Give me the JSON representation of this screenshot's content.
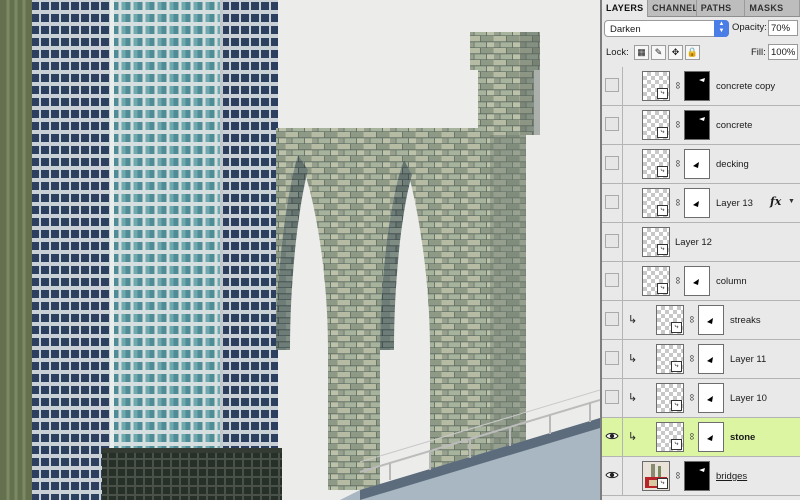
{
  "panel": {
    "tabs": [
      "LAYERS",
      "CHANNELS",
      "PATHS",
      "MASKS"
    ],
    "blend_mode": "Darken",
    "opacity_label": "Opacity:",
    "opacity_value": "70%",
    "lock_label": "Lock:",
    "fill_label": "Fill:",
    "fill_value": "100%"
  },
  "layers": [
    {
      "name": "concrete copy",
      "visible": false,
      "selected": false,
      "mask": "black"
    },
    {
      "name": "concrete",
      "visible": false,
      "selected": false,
      "mask": "black"
    },
    {
      "name": "decking",
      "visible": false,
      "selected": false,
      "mask": "white"
    },
    {
      "name": "Layer 13",
      "visible": false,
      "selected": false,
      "mask": "white",
      "fx": "fx"
    },
    {
      "name": "Layer 12",
      "visible": false,
      "selected": false,
      "mask": "none"
    },
    {
      "name": "column",
      "visible": false,
      "selected": false,
      "mask": "white"
    },
    {
      "name": "streaks",
      "visible": false,
      "selected": false,
      "mask": "white",
      "clipped": true
    },
    {
      "name": "Layer 11",
      "visible": false,
      "selected": false,
      "mask": "white",
      "clipped": true
    },
    {
      "name": "Layer 10",
      "visible": false,
      "selected": false,
      "mask": "white",
      "clipped": true
    },
    {
      "name": "stone",
      "visible": true,
      "selected": true,
      "mask": "white",
      "clipped": true
    },
    {
      "name": "bridges",
      "visible": true,
      "selected": false,
      "mask": "black"
    }
  ],
  "colors": {
    "selected_row": "#dcf5a3",
    "stone": "#9aa38c",
    "sky": "#ececea",
    "glass": "#3f6470"
  }
}
